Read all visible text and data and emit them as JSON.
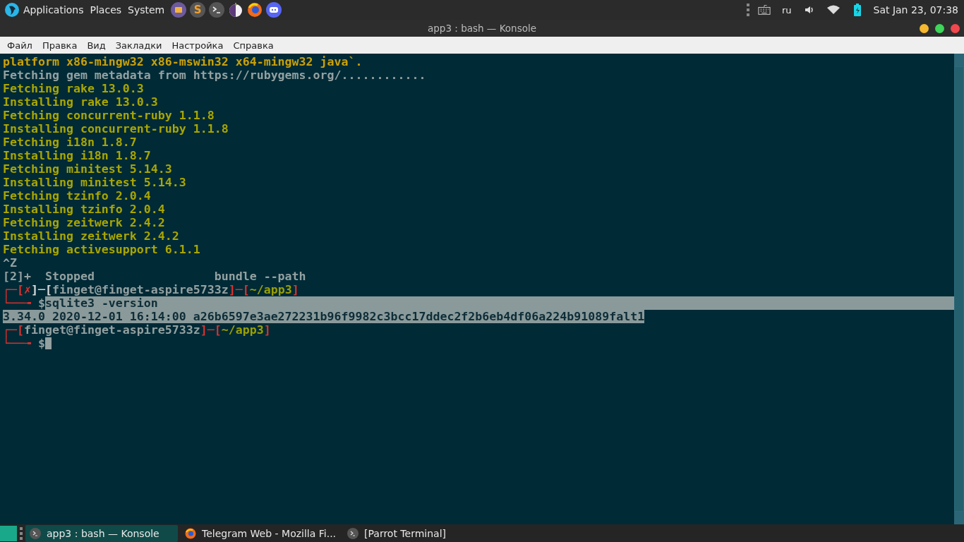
{
  "top_panel": {
    "menus": [
      "Applications",
      "Places",
      "System"
    ],
    "launchers": [
      {
        "kind": "folder"
      },
      {
        "kind": "letter",
        "glyph": "S"
      },
      {
        "kind": "terminal"
      },
      {
        "kind": "onion"
      },
      {
        "kind": "browser"
      },
      {
        "kind": "chat"
      }
    ],
    "layout": "ru",
    "clock": "Sat Jan 23, 07:38"
  },
  "window": {
    "title": "app3 : bash — Konsole"
  },
  "menu_bar": [
    "Файл",
    "Правка",
    "Вид",
    "Закладки",
    "Настройка",
    "Справка"
  ],
  "terminal": {
    "lines": [
      {
        "segments": [
          {
            "kind": "warning",
            "text": "platform x86-mingw32 x86-mswin32 x64-mingw32 java`.",
            "selected": false
          }
        ]
      },
      {
        "segments": [
          {
            "kind": "plain",
            "text": "Fetching gem metadata from https://rubygems.org/............",
            "selected": false
          }
        ]
      },
      {
        "segments": [
          {
            "kind": "progress",
            "text": "Fetching rake 13.0.3",
            "selected": false
          }
        ]
      },
      {
        "segments": [
          {
            "kind": "progress",
            "text": "Installing rake 13.0.3",
            "selected": false
          }
        ]
      },
      {
        "segments": [
          {
            "kind": "progress",
            "text": "Fetching concurrent-ruby 1.1.8",
            "selected": false
          }
        ]
      },
      {
        "segments": [
          {
            "kind": "progress",
            "text": "Installing concurrent-ruby 1.1.8",
            "selected": false
          }
        ]
      },
      {
        "segments": [
          {
            "kind": "progress",
            "text": "Fetching i18n 1.8.7",
            "selected": false
          }
        ]
      },
      {
        "segments": [
          {
            "kind": "progress",
            "text": "Installing i18n 1.8.7",
            "selected": false
          }
        ]
      },
      {
        "segments": [
          {
            "kind": "progress",
            "text": "Fetching minitest 5.14.3",
            "selected": false
          }
        ]
      },
      {
        "segments": [
          {
            "kind": "progress",
            "text": "Installing minitest 5.14.3",
            "selected": false
          }
        ]
      },
      {
        "segments": [
          {
            "kind": "progress",
            "text": "Fetching tzinfo 2.0.4",
            "selected": false
          }
        ]
      },
      {
        "segments": [
          {
            "kind": "progress",
            "text": "Installing tzinfo 2.0.4",
            "selected": false
          }
        ]
      },
      {
        "segments": [
          {
            "kind": "progress",
            "text": "Fetching zeitwerk 2.4.2",
            "selected": false
          }
        ]
      },
      {
        "segments": [
          {
            "kind": "progress",
            "text": "Installing zeitwerk 2.4.2",
            "selected": false
          }
        ]
      },
      {
        "segments": [
          {
            "kind": "progress",
            "text": "Fetching activesupport 6.1.1",
            "selected": false
          }
        ]
      },
      {
        "segments": [
          {
            "kind": "plain",
            "text": "^Z",
            "selected": false
          }
        ]
      },
      {
        "segments": [
          {
            "kind": "plain",
            "text": "[2]+  Stopped                 bundle --path",
            "selected": false
          }
        ]
      },
      {
        "segments": [
          {
            "kind": "frame",
            "text": "┌─[",
            "selected": false
          },
          {
            "kind": "error",
            "text": "✗",
            "selected": false
          },
          {
            "kind": "bright",
            "text": "]─[",
            "selected": false
          },
          {
            "kind": "plain",
            "text": "finget@finget-aspire5733z",
            "selected": false
          },
          {
            "kind": "frame",
            "text": "]─[",
            "selected": false
          },
          {
            "kind": "path",
            "text": "~/app3",
            "selected": false
          },
          {
            "kind": "frame",
            "text": "]",
            "selected": false
          }
        ]
      },
      {
        "selection_runs_on": true,
        "segments": [
          {
            "kind": "frame",
            "text": "└──╼ ",
            "selected": false
          },
          {
            "kind": "plain",
            "text": "$",
            "selected": false
          },
          {
            "text": "sqlite3 -version",
            "selected": true
          }
        ]
      },
      {
        "segments": [
          {
            "text": "3.34.0 2020-12-01 16:14:00 a26b6597e3ae272231b96f9982c3bcc17ddec2f2b6eb4df06a224b91089falt1",
            "selected": true
          }
        ]
      },
      {
        "segments": [
          {
            "kind": "frame",
            "text": "┌─[",
            "selected": false
          },
          {
            "kind": "plain",
            "text": "finget@finget-aspire5733z",
            "selected": false
          },
          {
            "kind": "frame",
            "text": "]─[",
            "selected": false
          },
          {
            "kind": "path",
            "text": "~/app3",
            "selected": false
          },
          {
            "kind": "frame",
            "text": "]",
            "selected": false
          }
        ]
      },
      {
        "cursor": true,
        "segments": [
          {
            "kind": "frame",
            "text": "└──╼ ",
            "selected": false
          },
          {
            "kind": "plain",
            "text": "$",
            "selected": false
          }
        ]
      }
    ]
  },
  "taskbar": {
    "tasks": [
      {
        "kind": "terminal",
        "label": "app3 : bash — Konsole",
        "selected": true
      },
      {
        "kind": "browser",
        "label": "Telegram Web - Mozilla Fi...",
        "selected": false
      },
      {
        "kind": "terminal",
        "label": "[Parrot Terminal]",
        "selected": false
      }
    ]
  }
}
